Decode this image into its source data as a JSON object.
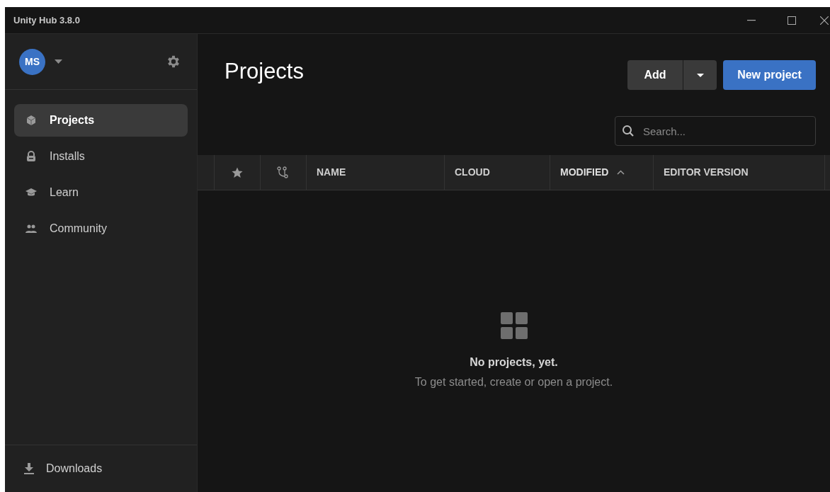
{
  "window": {
    "title": "Unity Hub 3.8.0"
  },
  "account": {
    "initials": "MS"
  },
  "sidebar": {
    "items": [
      {
        "label": "Projects",
        "selected": true
      },
      {
        "label": "Installs",
        "selected": false
      },
      {
        "label": "Learn",
        "selected": false
      },
      {
        "label": "Community",
        "selected": false
      }
    ],
    "footer": {
      "label": "Downloads"
    }
  },
  "page": {
    "title": "Projects"
  },
  "buttons": {
    "add": "Add",
    "new_project": "New project"
  },
  "search": {
    "placeholder": "Search..."
  },
  "table": {
    "columns": [
      {
        "kind": "star"
      },
      {
        "kind": "branch"
      },
      {
        "kind": "text",
        "label": "NAME",
        "sorted": false
      },
      {
        "kind": "text",
        "label": "CLOUD",
        "sorted": false
      },
      {
        "kind": "text",
        "label": "MODIFIED",
        "sorted": true
      },
      {
        "kind": "text",
        "label": "EDITOR VERSION",
        "sorted": false
      }
    ]
  },
  "empty_state": {
    "title": "No projects, yet.",
    "message": "To get started, create or open a project."
  }
}
